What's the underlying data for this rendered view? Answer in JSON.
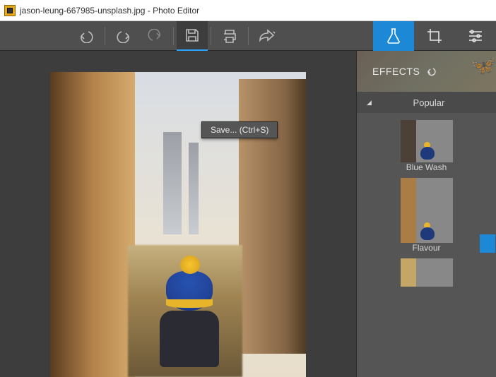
{
  "window": {
    "title": "jason-leung-667985-unsplash.jpg - Photo Editor"
  },
  "toolbar": {
    "undo": "Undo",
    "redo": "Redo",
    "redo2": "Redo",
    "save": "Save",
    "print": "Print",
    "share": "Share"
  },
  "tooltip": {
    "save": "Save... (Ctrl+S)"
  },
  "side": {
    "header": "EFFECTS",
    "category": "Popular",
    "items": [
      {
        "label": "Blue Wash"
      },
      {
        "label": "Flavour"
      },
      {
        "label": ""
      }
    ]
  },
  "tabs": {
    "lab": "Effects",
    "crop": "Crop",
    "sliders": "Adjust"
  }
}
